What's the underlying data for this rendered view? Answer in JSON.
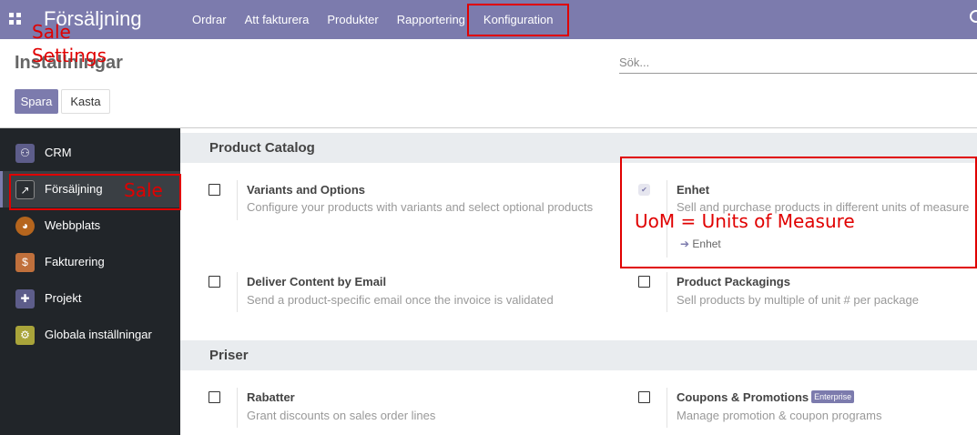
{
  "navbar": {
    "brand": "Försäljning",
    "menu": [
      "Ordrar",
      "Att fakturera",
      "Produkter",
      "Rapportering",
      "Konfiguration"
    ]
  },
  "control_panel": {
    "title": "Inställningar",
    "search_placeholder": "Sök...",
    "save_label": "Spara",
    "discard_label": "Kasta"
  },
  "sidebar": {
    "items": [
      {
        "label": "CRM",
        "icon": "handshake-icon",
        "color": "#5d5d8a"
      },
      {
        "label": "Försäljning",
        "icon": "sales-chart-icon",
        "color": "#3a3f44"
      },
      {
        "label": "Webbplats",
        "icon": "globe-icon",
        "color": "#b5651d"
      },
      {
        "label": "Fakturering",
        "icon": "invoice-icon",
        "color": "#c0703c"
      },
      {
        "label": "Projekt",
        "icon": "puzzle-icon",
        "color": "#5d5d8a"
      },
      {
        "label": "Globala inställningar",
        "icon": "gear-icon",
        "color": "#a9a43a"
      }
    ]
  },
  "sections": {
    "catalog": {
      "title": "Product Catalog",
      "variants": {
        "title": "Variants and Options",
        "desc": "Configure your products with variants and select optional products",
        "checked": false
      },
      "uom": {
        "title": "Enhet",
        "desc": "Sell and purchase products in different units of measure",
        "link": "Enhet",
        "checked": true
      },
      "deliver": {
        "title": "Deliver Content by Email",
        "desc": "Send a product-specific email once the invoice is validated",
        "checked": false
      },
      "packagings": {
        "title": "Product Packagings",
        "desc": "Sell products by multiple of unit # per package",
        "checked": false
      }
    },
    "pricing": {
      "title": "Priser",
      "discounts": {
        "title": "Rabatter",
        "desc": "Grant discounts on sales order lines",
        "checked": false
      },
      "coupons": {
        "title": "Coupons & Promotions",
        "badge": "Enterprise",
        "desc": "Manage promotion & coupon programs",
        "checked": false
      }
    }
  },
  "annotations": {
    "app_note_line1": "Sale",
    "app_note_line2": "Settings",
    "sidebar_note": "Sale",
    "uom_note": "UoM = Units of Measure"
  },
  "colors": {
    "brand": "#7c7bad",
    "annotation": "#e00000"
  }
}
